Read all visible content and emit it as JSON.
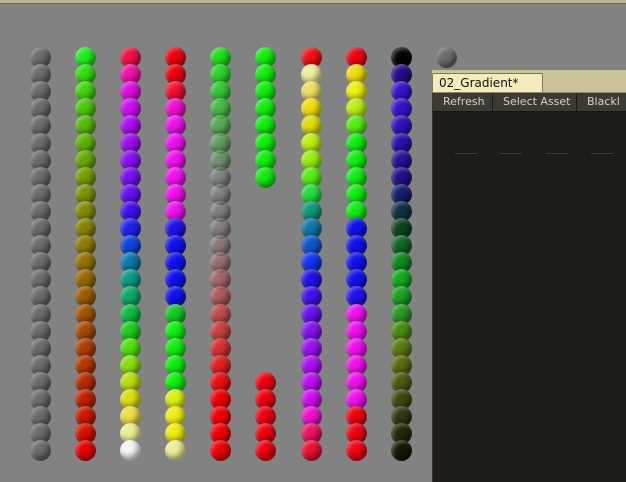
{
  "panel": {
    "tab_title": "02_Gradient*",
    "toolbar": {
      "refresh_label": "Refresh",
      "select_asset_label": "Select Asset",
      "blacklist_label": "Blackl"
    }
  },
  "colors": {
    "viewport_bg": "#828282",
    "panel_bg": "#1d1c17",
    "tab_bg": "#f3edbd"
  },
  "sphere_columns": [
    [
      "#6c6c6c",
      "#6c6c6c",
      "#6c6c6c",
      "#6c6c6c",
      "#6c6c6c",
      "#6c6c6c",
      "#6c6c6c",
      "#6c6c6c",
      "#6c6c6c",
      "#6c6c6c",
      "#6c6c6c",
      "#6c6c6c",
      "#6c6c6c",
      "#6c6c6c",
      "#6c6c6c",
      "#6c6c6c",
      "#6c6c6c",
      "#6c6c6c",
      "#6c6c6c",
      "#6c6c6c",
      "#6c6c6c",
      "#6c6c6c",
      "#6c6c6c",
      "#6c6c6c"
    ],
    [
      "#22ee22",
      "#33dd11",
      "#44d411",
      "#4cc80c",
      "#55bb0a",
      "#5fb208",
      "#68a806",
      "#739e05",
      "#7c9405",
      "#858c05",
      "#8a8204",
      "#8e7a04",
      "#937004",
      "#986704",
      "#9c5d04",
      "#a25304",
      "#a64a04",
      "#ac3f04",
      "#b23604",
      "#b82c04",
      "#be2204",
      "#c81a04",
      "#d41104",
      "#e80000"
    ],
    [
      "#ee1144",
      "#ee11aa",
      "#dd11dd",
      "#cc11ee",
      "#aa11ee",
      "#9911ee",
      "#8811ee",
      "#7711ee",
      "#6611ee",
      "#4411ee",
      "#2222ee",
      "#1144dd",
      "#1177aa",
      "#119988",
      "#11aa66",
      "#11bb44",
      "#22cc22",
      "#55dd11",
      "#88dd11",
      "#bbdd11",
      "#dddd11",
      "#eedd44",
      "#eeee99",
      "#f5f5f5"
    ],
    [
      "#ee0011",
      "#ee0011",
      "#ee1133",
      "#ee11cc",
      "#ee11ee",
      "#ee11ee",
      "#ee11ee",
      "#ee11ee",
      "#ee11ee",
      "#ee11ee",
      "#2211ee",
      "#1111ee",
      "#1111ee",
      "#1111ee",
      "#1111ee",
      "#11cc22",
      "#11ee11",
      "#11ee11",
      "#11ee11",
      "#11ee11",
      "#ddee11",
      "#eeee11",
      "#eeee11",
      "#eeee99"
    ],
    [
      "rgba(34,220,34,1)",
      "rgba(34,220,34,0.9)",
      "rgba(34,220,34,0.75)",
      "rgba(34,220,34,0.6)",
      "rgba(34,220,34,0.45)",
      "rgba(34,220,34,0.3)",
      "rgba(34,220,34,0.18)",
      "rgba(80,160,80,0.08)",
      "rgba(128,128,128,0.05)",
      "rgba(130,110,110,0.08)",
      "rgba(150,100,100,0.15)",
      "rgba(170,90,90,0.25)",
      "rgba(190,80,80,0.35)",
      "rgba(200,70,70,0.45)",
      "rgba(210,60,60,0.55)",
      "rgba(220,50,50,0.65)",
      "rgba(225,40,40,0.72)",
      "rgba(230,30,30,0.8)",
      "rgba(235,20,20,0.88)",
      "rgba(240,10,10,0.94)",
      "rgba(240,0,0,1)",
      "rgba(240,0,0,1)",
      "rgba(240,0,0,1)",
      "rgba(240,0,0,1)"
    ],
    [
      "#11ee11",
      "#11ee11",
      "#11ee11",
      "#11ee11",
      "#11ee11",
      "#11ee11",
      "#11ee11",
      "#11ee11",
      "",
      "",
      "",
      "",
      "",
      "",
      "",
      "",
      "",
      "",
      "",
      "#ee0011",
      "#ee0011",
      "#ee0011",
      "#ee0011",
      "#ee0011"
    ],
    [
      "#ee1111",
      "#eeee99",
      "#eedd66",
      "#eedd11",
      "#dddd11",
      "#bbee11",
      "#99ee11",
      "#55ee11",
      "#22dd44",
      "#119977",
      "#1177aa",
      "#1155cc",
      "#1133ee",
      "#2211ee",
      "#4411ee",
      "#6611ee",
      "#8811ee",
      "#9911ee",
      "#aa11ee",
      "#bb11ee",
      "#cc11ee",
      "#ee11cc",
      "#ee1166",
      "#ee1133"
    ],
    [
      "#ee0011",
      "#eedd11",
      "#eeee11",
      "#bbee11",
      "#55ee11",
      "#11ee11",
      "#11ee11",
      "#11ee11",
      "#11ee11",
      "#11ee11",
      "#1111ee",
      "#1111ee",
      "#1111ee",
      "#1111ee",
      "#2211ee",
      "#ee11ee",
      "#ee11ee",
      "#ee11ee",
      "#ee11ee",
      "#ee11ee",
      "#ee11ee",
      "#ee0011",
      "#ee0011",
      "#ee0011"
    ],
    [
      "#050505",
      "#2a0a88",
      "#3a11cc",
      "#3a11cc",
      "#3311bb",
      "#2b11aa",
      "#2a119a",
      "#220f88",
      "#151e6e",
      "#0e3344",
      "#0e4422",
      "#116622",
      "#118822",
      "#11aa22",
      "#1aa022",
      "#2b9a22",
      "#4c8a11",
      "#5a7a11",
      "#5a6a11",
      "#4c5a11",
      "#3e4a11",
      "#2f3a11",
      "#212a08",
      "#141804"
    ],
    [
      "#6c6c6c"
    ]
  ]
}
